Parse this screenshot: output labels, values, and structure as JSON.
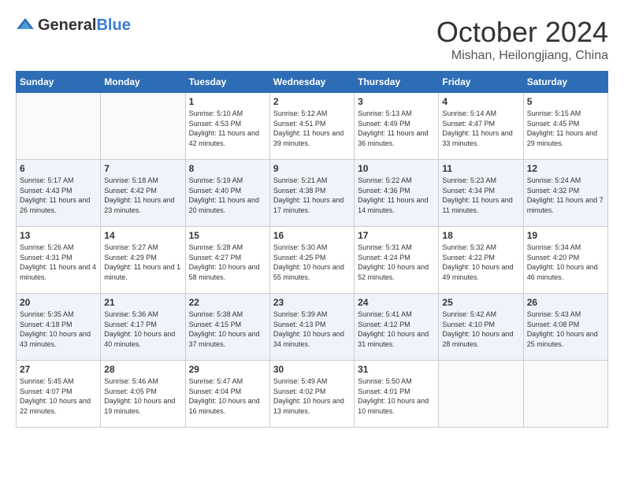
{
  "header": {
    "logo_general": "General",
    "logo_blue": "Blue",
    "month": "October 2024",
    "location": "Mishan, Heilongjiang, China"
  },
  "days_of_week": [
    "Sunday",
    "Monday",
    "Tuesday",
    "Wednesday",
    "Thursday",
    "Friday",
    "Saturday"
  ],
  "weeks": [
    [
      {
        "day": "",
        "details": ""
      },
      {
        "day": "",
        "details": ""
      },
      {
        "day": "1",
        "details": "Sunrise: 5:10 AM\nSunset: 4:53 PM\nDaylight: 11 hours and 42 minutes."
      },
      {
        "day": "2",
        "details": "Sunrise: 5:12 AM\nSunset: 4:51 PM\nDaylight: 11 hours and 39 minutes."
      },
      {
        "day": "3",
        "details": "Sunrise: 5:13 AM\nSunset: 4:49 PM\nDaylight: 11 hours and 36 minutes."
      },
      {
        "day": "4",
        "details": "Sunrise: 5:14 AM\nSunset: 4:47 PM\nDaylight: 11 hours and 33 minutes."
      },
      {
        "day": "5",
        "details": "Sunrise: 5:15 AM\nSunset: 4:45 PM\nDaylight: 11 hours and 29 minutes."
      }
    ],
    [
      {
        "day": "6",
        "details": "Sunrise: 5:17 AM\nSunset: 4:43 PM\nDaylight: 11 hours and 26 minutes."
      },
      {
        "day": "7",
        "details": "Sunrise: 5:18 AM\nSunset: 4:42 PM\nDaylight: 11 hours and 23 minutes."
      },
      {
        "day": "8",
        "details": "Sunrise: 5:19 AM\nSunset: 4:40 PM\nDaylight: 11 hours and 20 minutes."
      },
      {
        "day": "9",
        "details": "Sunrise: 5:21 AM\nSunset: 4:38 PM\nDaylight: 11 hours and 17 minutes."
      },
      {
        "day": "10",
        "details": "Sunrise: 5:22 AM\nSunset: 4:36 PM\nDaylight: 11 hours and 14 minutes."
      },
      {
        "day": "11",
        "details": "Sunrise: 5:23 AM\nSunset: 4:34 PM\nDaylight: 11 hours and 11 minutes."
      },
      {
        "day": "12",
        "details": "Sunrise: 5:24 AM\nSunset: 4:32 PM\nDaylight: 11 hours and 7 minutes."
      }
    ],
    [
      {
        "day": "13",
        "details": "Sunrise: 5:26 AM\nSunset: 4:31 PM\nDaylight: 11 hours and 4 minutes."
      },
      {
        "day": "14",
        "details": "Sunrise: 5:27 AM\nSunset: 4:29 PM\nDaylight: 11 hours and 1 minute."
      },
      {
        "day": "15",
        "details": "Sunrise: 5:28 AM\nSunset: 4:27 PM\nDaylight: 10 hours and 58 minutes."
      },
      {
        "day": "16",
        "details": "Sunrise: 5:30 AM\nSunset: 4:25 PM\nDaylight: 10 hours and 55 minutes."
      },
      {
        "day": "17",
        "details": "Sunrise: 5:31 AM\nSunset: 4:24 PM\nDaylight: 10 hours and 52 minutes."
      },
      {
        "day": "18",
        "details": "Sunrise: 5:32 AM\nSunset: 4:22 PM\nDaylight: 10 hours and 49 minutes."
      },
      {
        "day": "19",
        "details": "Sunrise: 5:34 AM\nSunset: 4:20 PM\nDaylight: 10 hours and 46 minutes."
      }
    ],
    [
      {
        "day": "20",
        "details": "Sunrise: 5:35 AM\nSunset: 4:18 PM\nDaylight: 10 hours and 43 minutes."
      },
      {
        "day": "21",
        "details": "Sunrise: 5:36 AM\nSunset: 4:17 PM\nDaylight: 10 hours and 40 minutes."
      },
      {
        "day": "22",
        "details": "Sunrise: 5:38 AM\nSunset: 4:15 PM\nDaylight: 10 hours and 37 minutes."
      },
      {
        "day": "23",
        "details": "Sunrise: 5:39 AM\nSunset: 4:13 PM\nDaylight: 10 hours and 34 minutes."
      },
      {
        "day": "24",
        "details": "Sunrise: 5:41 AM\nSunset: 4:12 PM\nDaylight: 10 hours and 31 minutes."
      },
      {
        "day": "25",
        "details": "Sunrise: 5:42 AM\nSunset: 4:10 PM\nDaylight: 10 hours and 28 minutes."
      },
      {
        "day": "26",
        "details": "Sunrise: 5:43 AM\nSunset: 4:08 PM\nDaylight: 10 hours and 25 minutes."
      }
    ],
    [
      {
        "day": "27",
        "details": "Sunrise: 5:45 AM\nSunset: 4:07 PM\nDaylight: 10 hours and 22 minutes."
      },
      {
        "day": "28",
        "details": "Sunrise: 5:46 AM\nSunset: 4:05 PM\nDaylight: 10 hours and 19 minutes."
      },
      {
        "day": "29",
        "details": "Sunrise: 5:47 AM\nSunset: 4:04 PM\nDaylight: 10 hours and 16 minutes."
      },
      {
        "day": "30",
        "details": "Sunrise: 5:49 AM\nSunset: 4:02 PM\nDaylight: 10 hours and 13 minutes."
      },
      {
        "day": "31",
        "details": "Sunrise: 5:50 AM\nSunset: 4:01 PM\nDaylight: 10 hours and 10 minutes."
      },
      {
        "day": "",
        "details": ""
      },
      {
        "day": "",
        "details": ""
      }
    ]
  ]
}
